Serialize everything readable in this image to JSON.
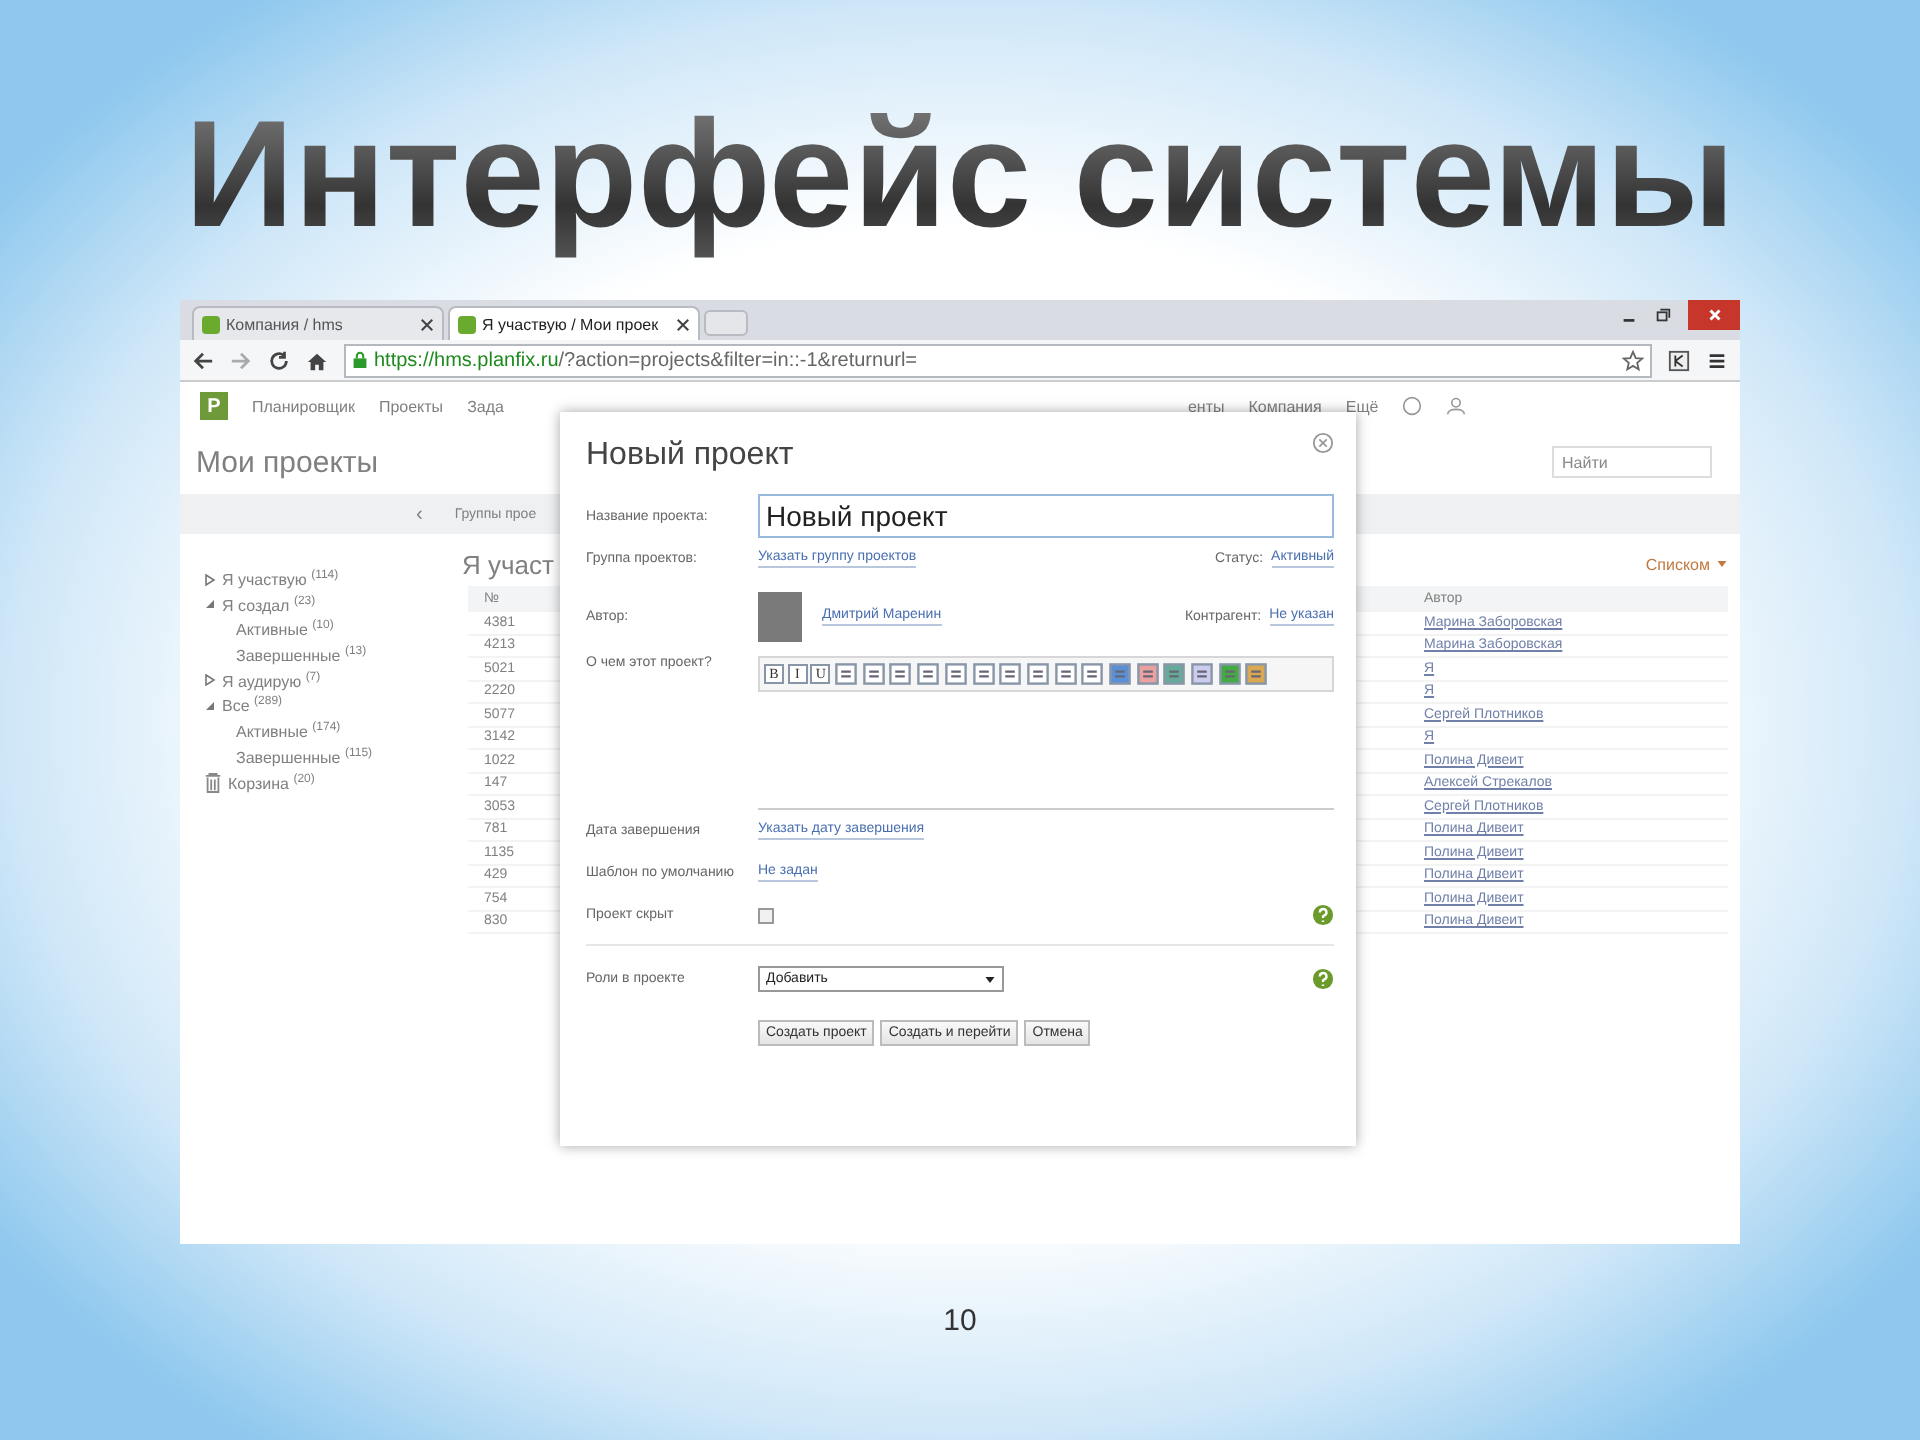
{
  "slide": {
    "title": "Интерфейс системы",
    "page_number": "10"
  },
  "browser": {
    "tabs": [
      {
        "label": "Компания / hms",
        "selected": false
      },
      {
        "label": "Я участвую / Мои проек",
        "selected": true
      }
    ],
    "url": {
      "secure_part": "https://hms.planfix.ru",
      "rest": "/?action=projects&filter=in::-1&returnurl="
    }
  },
  "app": {
    "logo": "P",
    "nav": [
      "Планировщик",
      "Проекты",
      "Зада",
      "енты",
      "Компания",
      "Ещё"
    ],
    "page_title": "Мои проекты",
    "search": {
      "placeholder": "Найти"
    },
    "breadcrumb": "Группы прое",
    "collapse": "‹",
    "sidebar": [
      {
        "label": "Я участвую",
        "count": "(114)",
        "expanded": false
      },
      {
        "label": "Я создал",
        "count": "(23)",
        "expanded": true,
        "children": [
          {
            "label": "Активные",
            "count": "(10)"
          },
          {
            "label": "Завершенные",
            "count": "(13)"
          }
        ]
      },
      {
        "label": "Я аудирую",
        "count": "(7)",
        "expanded": false
      },
      {
        "label": "Все",
        "count": "(289)",
        "expanded": true,
        "children": [
          {
            "label": "Активные",
            "count": "(174)"
          },
          {
            "label": "Завершенные",
            "count": "(115)"
          }
        ]
      }
    ],
    "trash": {
      "label": "Корзина",
      "count": "(20)"
    },
    "list_title": "Я участ",
    "view_mode": "Списком",
    "table": {
      "columns": [
        "№",
        "Автор"
      ],
      "rows": [
        [
          "4381",
          "Марина Заборовская"
        ],
        [
          "4213",
          "Марина Заборовская"
        ],
        [
          "5021",
          "Я"
        ],
        [
          "2220",
          "Я"
        ],
        [
          "5077",
          "Сергей Плотников"
        ],
        [
          "3142",
          "Я"
        ],
        [
          "1022",
          "Полина Дивеит"
        ],
        [
          "147",
          "Алексей Стрекалов"
        ],
        [
          "3053",
          "Сергей Плотников"
        ],
        [
          "781",
          "Полина Дивеит"
        ],
        [
          "1135",
          "Полина Дивеит"
        ],
        [
          "429",
          "Полина Дивеит"
        ],
        [
          "754",
          "Полина Дивеит"
        ],
        [
          "830",
          "Полина Дивеит"
        ]
      ]
    }
  },
  "dialog": {
    "title": "Новый проект",
    "name": {
      "label": "Название проекта:",
      "value": "Новый проект"
    },
    "group": {
      "label": "Группа проектов:",
      "link": "Указать группу проектов"
    },
    "status": {
      "label": "Статус:",
      "link": "Активный"
    },
    "author": {
      "label": "Автор:",
      "link": "Дмитрий Маренин"
    },
    "counterparty": {
      "label": "Контрагент:",
      "link": "Не указан"
    },
    "about": {
      "label": "О чем этот проект?",
      "toolbar_letters": [
        "B",
        "I",
        "U"
      ]
    },
    "due_date": {
      "label": "Дата завершения",
      "link": "Указать дату завершения"
    },
    "template": {
      "label": "Шаблон по умолчанию",
      "link": "Не задан"
    },
    "hidden": {
      "label": "Проект скрыт",
      "checked": false
    },
    "roles": {
      "label": "Роли в проекте",
      "value": "Добавить"
    },
    "buttons": [
      "Создать проект",
      "Создать и перейти",
      "Отмена"
    ]
  }
}
